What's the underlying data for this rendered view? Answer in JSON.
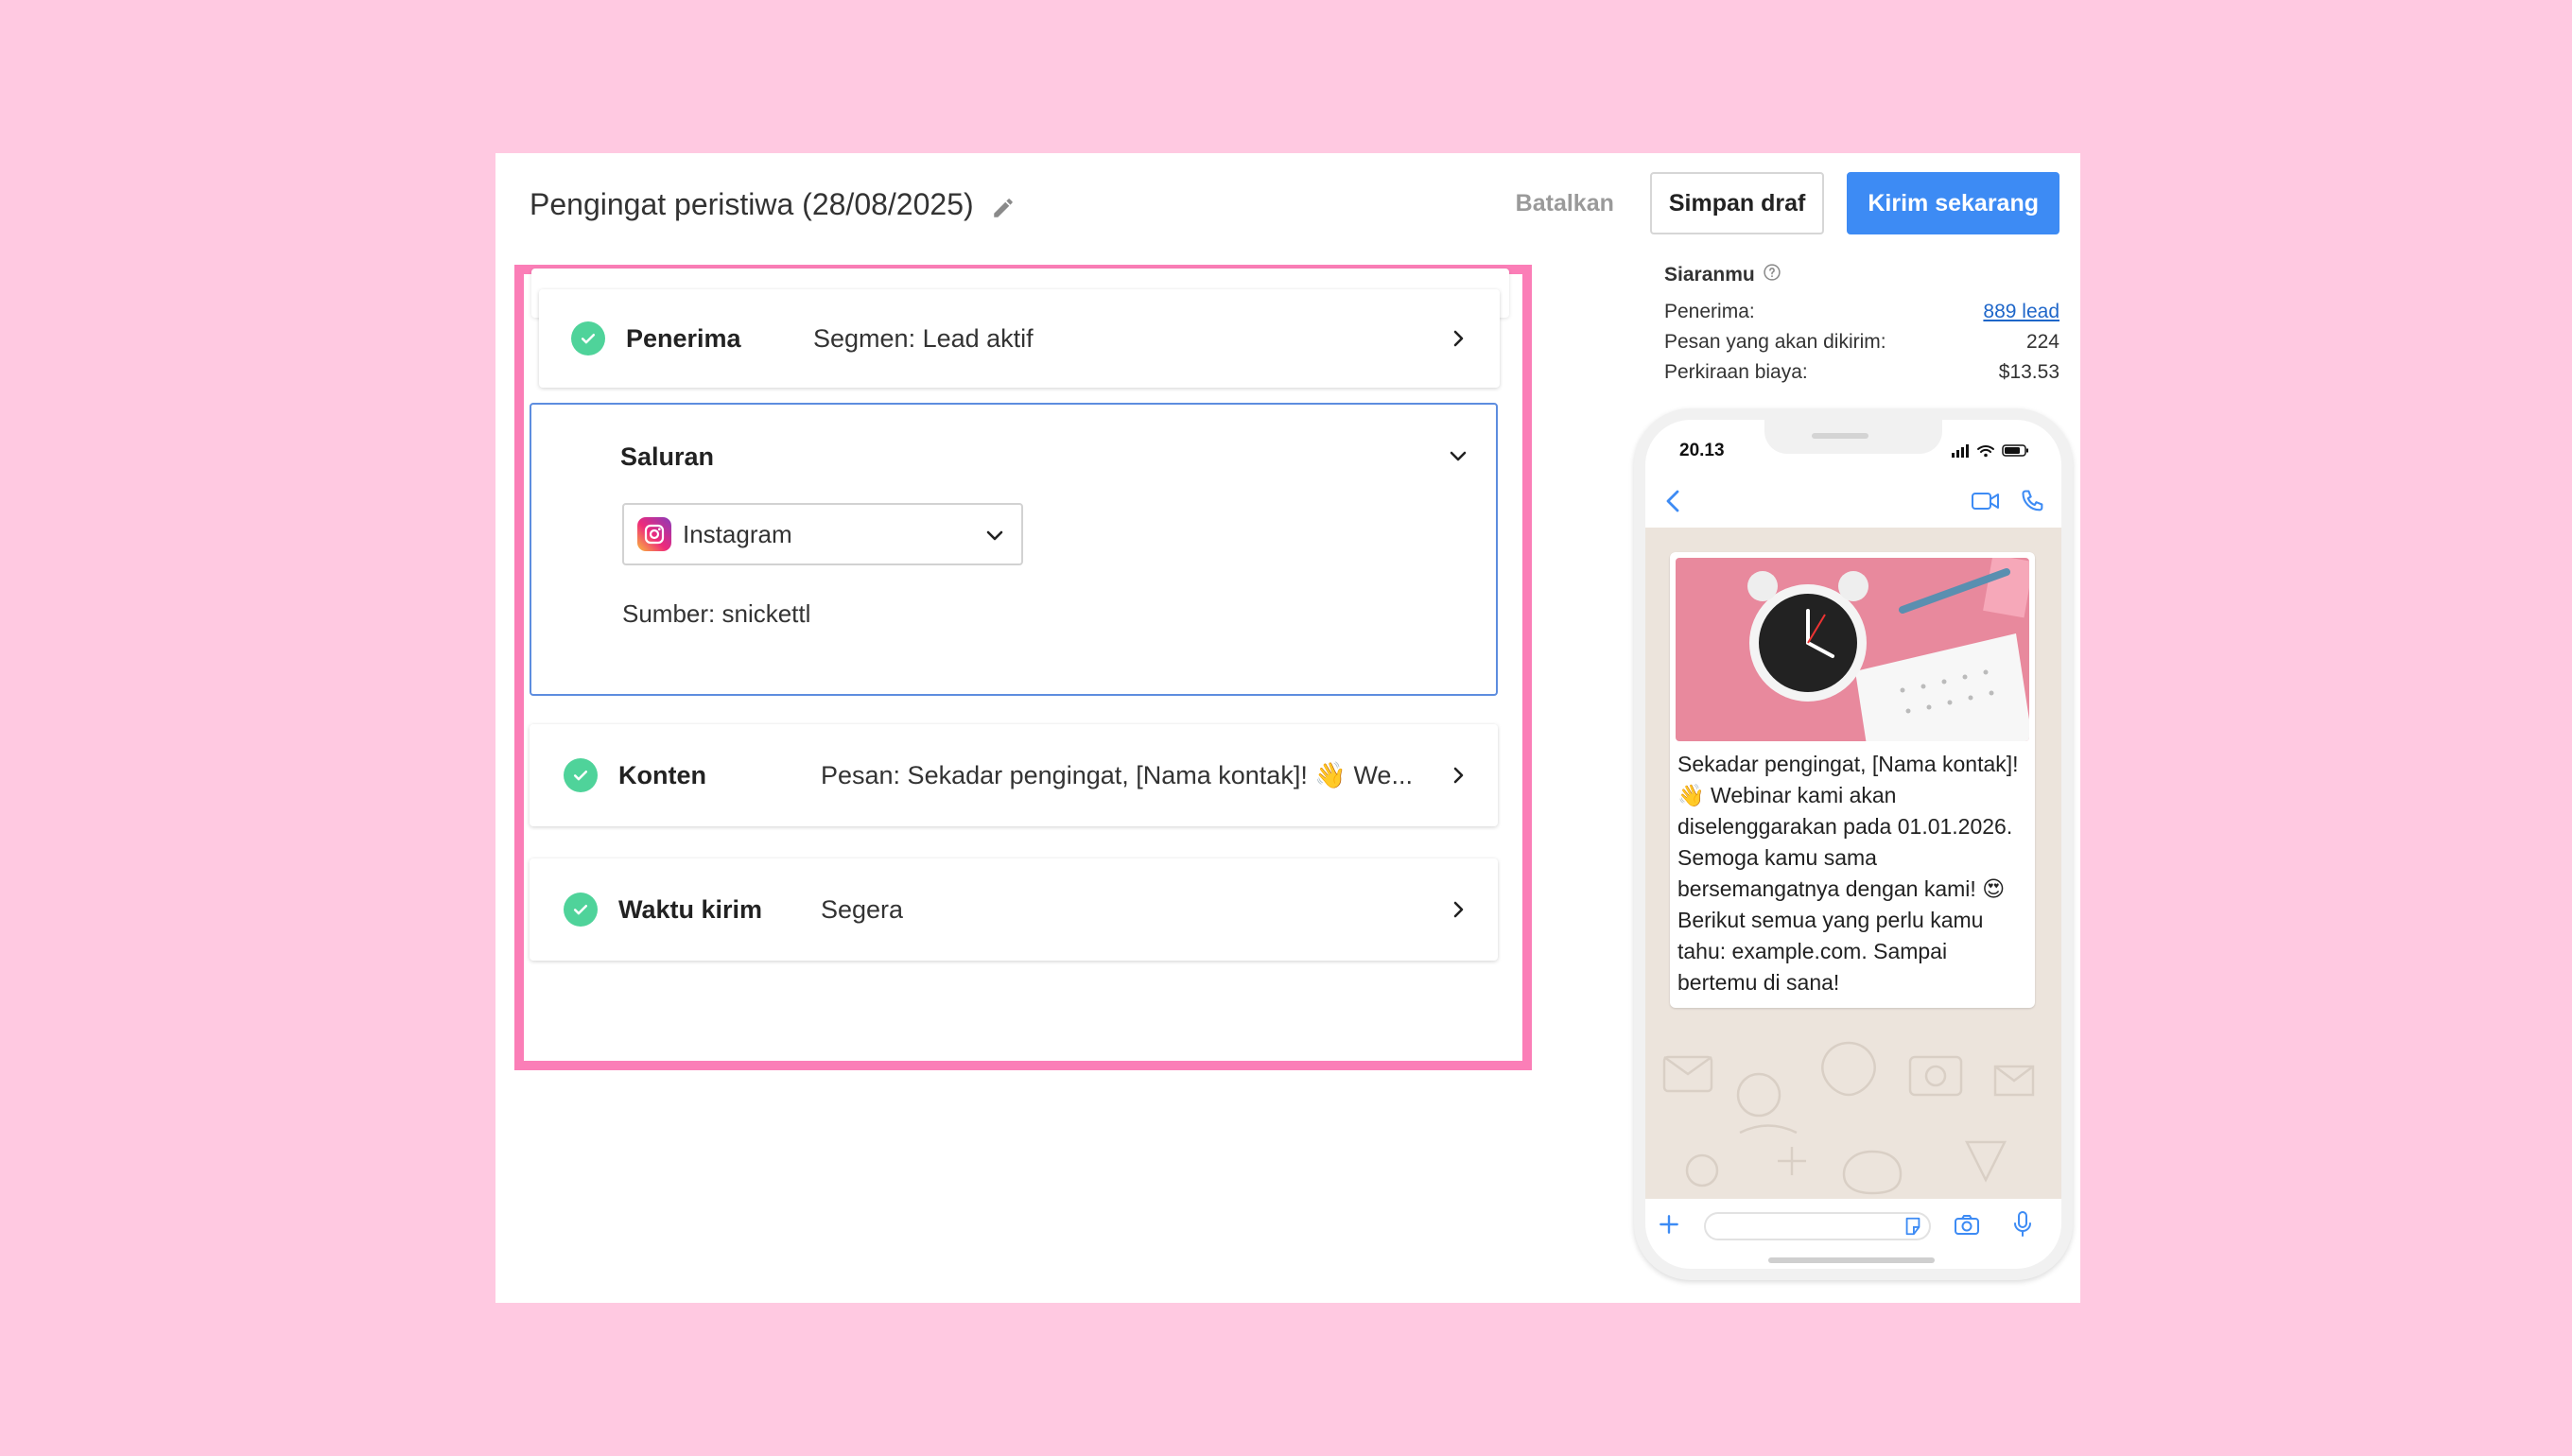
{
  "header": {
    "title": "Pengingat peristiwa (28/08/2025)",
    "cancel_label": "Batalkan",
    "draft_label": "Simpan draf",
    "send_label": "Kirim sekarang"
  },
  "steps": {
    "recipients": {
      "label": "Penerima",
      "value": "Segmen: Lead aktif"
    },
    "channel": {
      "label": "Saluran",
      "selected": "Instagram",
      "source": "Sumber: snickettl"
    },
    "content": {
      "label": "Konten",
      "value": "Pesan: Sekadar pengingat, [Nama kontak]! 👋 We..."
    },
    "send_time": {
      "label": "Waktu kirim",
      "value": "Segera"
    }
  },
  "summary": {
    "title": "Siaranmu",
    "rows": [
      {
        "label": "Penerima:",
        "value": "889 lead"
      },
      {
        "label": "Pesan yang akan dikirim:",
        "value": "224"
      },
      {
        "label": "Perkiraan biaya:",
        "value": "$13.53"
      }
    ]
  },
  "phone": {
    "time": "20.13",
    "message": "Sekadar pengingat, [Nama kontak]! 👋 Webinar kami akan diselenggarakan pada 01.01.2026. Semoga kamu sama bersemangatnya dengan kami! 😍 Berikut semua yang perlu kamu tahu: example.com. Sampai bertemu di sana!"
  },
  "colors": {
    "accent": "#3d8bf4",
    "highlight": "#fb7eb7",
    "check": "#4fd39a",
    "background": "#ffc9e1"
  }
}
